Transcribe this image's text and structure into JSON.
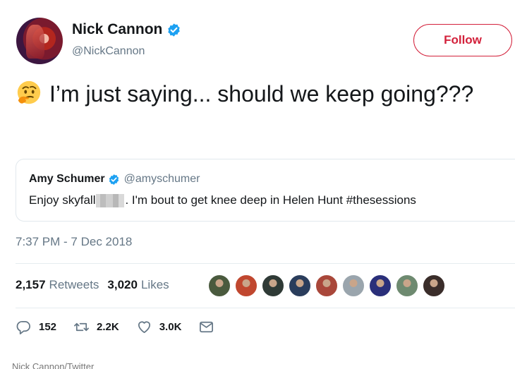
{
  "user": {
    "display_name": "Nick Cannon",
    "handle": "@NickCannon",
    "follow_label": "Follow"
  },
  "tweet": {
    "text": "I’m just saying... should we keep going???",
    "timestamp": "7:37 PM - 7 Dec 2018"
  },
  "quote": {
    "display_name": "Amy Schumer",
    "handle": "@amyschumer",
    "text_before": "Enjoy skyfall",
    "text_after": ". I'm bout to get knee deep in Helen Hunt #thesessions"
  },
  "stats": {
    "retweets_count": "2,157",
    "retweets_label": "Retweets",
    "likes_count": "3,020",
    "likes_label": "Likes"
  },
  "liker_colors": [
    "#4a5a3e",
    "#c0472f",
    "#2f3a36",
    "#2a3d5c",
    "#a9473a",
    "#9aa5ad",
    "#2a2f7a",
    "#6e8a70",
    "#3a2d2a"
  ],
  "actions": {
    "reply_count": "152",
    "retweet_count": "2.2K",
    "like_count": "3.0K"
  },
  "caption": "Nick Cannon/Twitter",
  "colors": {
    "brand_red": "#d3213b",
    "verified_blue": "#1da1f2",
    "secondary_text": "#657786"
  }
}
